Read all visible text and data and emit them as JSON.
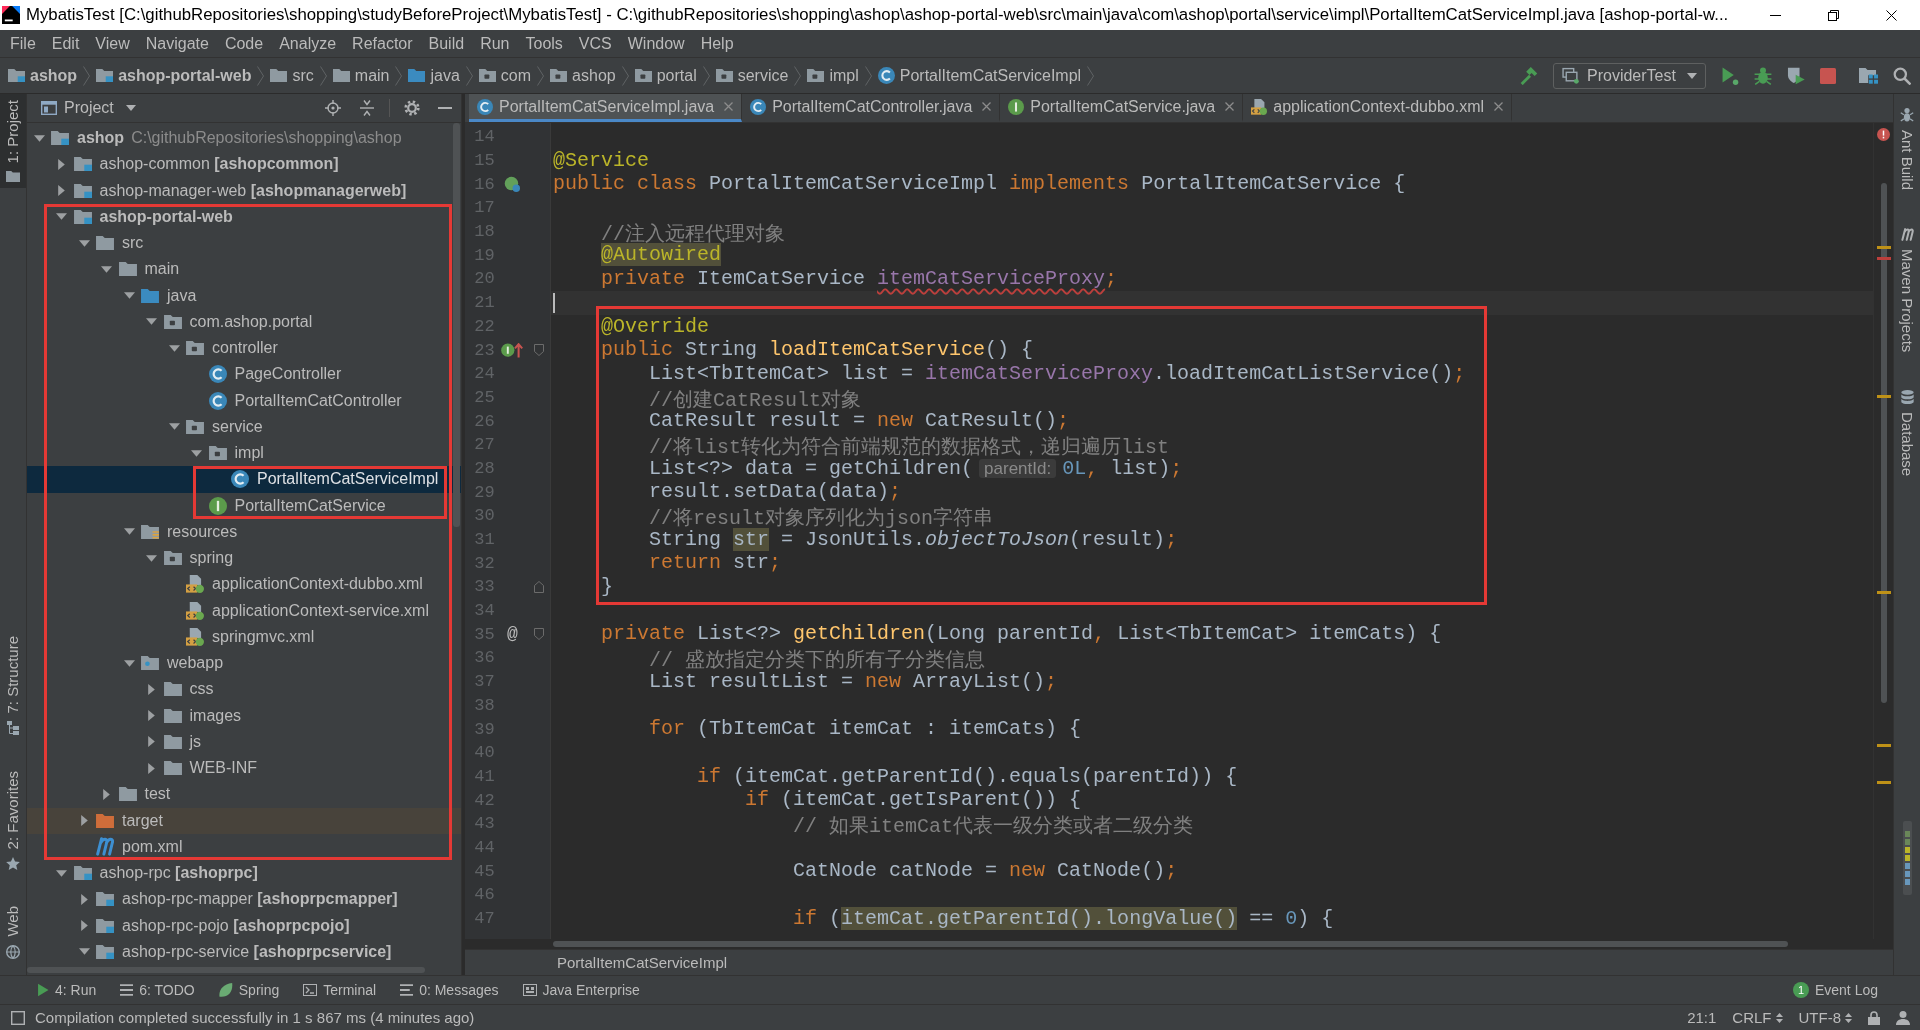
{
  "window": {
    "title": "MybatisTest [C:\\githubRepositories\\shopping\\studyBeforeProject\\MybatisTest] - C:\\githubRepositories\\shopping\\ashop\\ashop-portal-web\\src\\main\\java\\com\\ashop\\portal\\service\\impl\\PortalItemCatServiceImpl.java [ashop-portal-w..."
  },
  "menu": [
    "File",
    "Edit",
    "View",
    "Navigate",
    "Code",
    "Analyze",
    "Refactor",
    "Build",
    "Run",
    "Tools",
    "VCS",
    "Window",
    "Help"
  ],
  "breadcrumbs": [
    {
      "label": "ashop",
      "kind": "module"
    },
    {
      "label": "ashop-portal-web",
      "kind": "module"
    },
    {
      "label": "src",
      "kind": "folder"
    },
    {
      "label": "main",
      "kind": "folder"
    },
    {
      "label": "java",
      "kind": "source-root"
    },
    {
      "label": "com",
      "kind": "package"
    },
    {
      "label": "ashop",
      "kind": "package"
    },
    {
      "label": "portal",
      "kind": "package"
    },
    {
      "label": "service",
      "kind": "package"
    },
    {
      "label": "impl",
      "kind": "package"
    },
    {
      "label": "PortalItemCatServiceImpl",
      "kind": "class"
    }
  ],
  "run_config": {
    "label": "ProviderTest"
  },
  "left_strip": {
    "top": [
      {
        "label": "1: Project",
        "kind": "project",
        "selected": true
      }
    ],
    "bottom": [
      {
        "label": "7: Structure",
        "kind": "structure",
        "selected": false
      },
      {
        "label": "2: Favorites",
        "kind": "favorites",
        "selected": false
      },
      {
        "label": "Web",
        "kind": "web",
        "selected": false
      }
    ]
  },
  "right_strip": [
    {
      "label": "Ant Build",
      "kind": "ant"
    },
    {
      "label": "Maven Projects",
      "kind": "maven"
    },
    {
      "label": "Database",
      "kind": "database"
    }
  ],
  "project": {
    "title": "Project",
    "tree": [
      {
        "label": "ashop",
        "kind": "module",
        "bold": true,
        "path": "C:\\githubRepositories\\shopping\\ashop",
        "expanded": true,
        "selected": false,
        "children": [
          {
            "label": "ashop-common **[ashopcommon]**",
            "kind": "module",
            "bold": false,
            "expanded": false,
            "selected": false
          },
          {
            "label": "ashop-manager-web **[ashopmanagerweb]**",
            "kind": "module",
            "bold": false,
            "expanded": false,
            "selected": false
          },
          {
            "label": "ashop-portal-web",
            "kind": "module",
            "bold": true,
            "expanded": true,
            "selected": false,
            "framed": true,
            "children": [
              {
                "label": "src",
                "kind": "folder",
                "expanded": true,
                "selected": false,
                "children": [
                  {
                    "label": "main",
                    "kind": "folder",
                    "expanded": true,
                    "selected": false,
                    "children": [
                      {
                        "label": "java",
                        "kind": "source-root",
                        "expanded": true,
                        "selected": false,
                        "children": [
                          {
                            "label": "com.ashop.portal",
                            "kind": "package",
                            "expanded": true,
                            "selected": false,
                            "children": [
                              {
                                "label": "controller",
                                "kind": "package",
                                "expanded": true,
                                "selected": false,
                                "children": [
                                  {
                                    "label": "PageController",
                                    "kind": "class",
                                    "selected": false
                                  },
                                  {
                                    "label": "PortalItemCatController",
                                    "kind": "class",
                                    "selected": false
                                  }
                                ]
                              },
                              {
                                "label": "service",
                                "kind": "package",
                                "expanded": true,
                                "selected": false,
                                "children": [
                                  {
                                    "label": "impl",
                                    "kind": "package",
                                    "expanded": true,
                                    "selected": false,
                                    "children": [
                                      {
                                        "label": "PortalItemCatServiceImpl",
                                        "kind": "class",
                                        "selected": true,
                                        "framed": true
                                      }
                                    ]
                                  },
                                  {
                                    "label": "PortalItemCatService",
                                    "kind": "interface",
                                    "selected": false,
                                    "framed": true
                                  }
                                ]
                              }
                            ]
                          }
                        ]
                      },
                      {
                        "label": "resources",
                        "kind": "resources-root",
                        "expanded": true,
                        "selected": false,
                        "children": [
                          {
                            "label": "spring",
                            "kind": "package",
                            "expanded": true,
                            "selected": false,
                            "children": [
                              {
                                "label": "applicationContext-dubbo.xml",
                                "kind": "spring-xml",
                                "selected": false
                              },
                              {
                                "label": "applicationContext-service.xml",
                                "kind": "spring-xml",
                                "selected": false
                              },
                              {
                                "label": "springmvc.xml",
                                "kind": "spring-xml",
                                "selected": false
                              }
                            ]
                          }
                        ]
                      },
                      {
                        "label": "webapp",
                        "kind": "web-root",
                        "expanded": true,
                        "selected": false,
                        "children": [
                          {
                            "label": "css",
                            "kind": "folder",
                            "expanded": false,
                            "selected": false
                          },
                          {
                            "label": "images",
                            "kind": "folder",
                            "expanded": false,
                            "selected": false
                          },
                          {
                            "label": "js",
                            "kind": "folder",
                            "expanded": false,
                            "selected": false
                          },
                          {
                            "label": "WEB-INF",
                            "kind": "folder",
                            "expanded": false,
                            "selected": false
                          }
                        ]
                      }
                    ]
                  },
                  {
                    "label": "test",
                    "kind": "folder",
                    "expanded": false,
                    "selected": false
                  }
                ]
              },
              {
                "label": "target",
                "kind": "excluded",
                "expanded": false,
                "selected": false
              },
              {
                "label": "pom.xml",
                "kind": "maven",
                "selected": false
              }
            ]
          },
          {
            "label": "ashop-rpc **[ashoprpc]**",
            "kind": "module",
            "bold": false,
            "expanded": true,
            "selected": false,
            "children": [
              {
                "label": "ashop-rpc-mapper **[ashoprpcmapper]**",
                "kind": "module",
                "bold": false,
                "expanded": false,
                "selected": false
              },
              {
                "label": "ashop-rpc-pojo **[ashoprpcpojo]**",
                "kind": "module",
                "bold": false,
                "expanded": false,
                "selected": false
              },
              {
                "label": "ashop-rpc-service **[ashoprpcservice]**",
                "kind": "module",
                "bold": false,
                "expanded": true,
                "selected": false
              }
            ]
          }
        ]
      }
    ]
  },
  "editor": {
    "tabs": [
      {
        "label": "PortalItemCatServiceImpl.java",
        "kind": "class",
        "selected": true
      },
      {
        "label": "PortalItemCatController.java",
        "kind": "class",
        "selected": false
      },
      {
        "label": "PortalItemCatService.java",
        "kind": "interface",
        "selected": false
      },
      {
        "label": "applicationContext-dubbo.xml",
        "kind": "spring-xml",
        "selected": false
      }
    ],
    "blocks": [
      {
        "lines": [
          {
            "number": "14",
            "current": false
          },
          {
            "number": "15",
            "current": false,
            "tokens": [
              {
                "text": "@Service",
                "kind": "annotation"
              }
            ]
          },
          {
            "number": "16",
            "current": false,
            "gutter": {
              "kind": "bean"
            },
            "tokens": [
              {
                "text": "public class",
                "kind": "keyword"
              },
              {
                "text": " PortalItemCatServiceImpl ",
                "kind": "plain"
              },
              {
                "text": "implements",
                "kind": "keyword"
              },
              {
                "text": " PortalItemCatService {",
                "kind": "plain"
              }
            ]
          },
          {
            "number": "17",
            "current": false
          },
          {
            "number": "18",
            "current": false,
            "tokens": [
              {
                "text": "    //注入远程代理对象",
                "kind": "comment"
              }
            ]
          },
          {
            "number": "19",
            "current": false,
            "tokens": [
              {
                "text": "    @Autowired",
                "kind": "annotation",
                "warning": true
              }
            ]
          },
          {
            "number": "20",
            "current": false,
            "tokens": [
              {
                "text": "    private",
                "kind": "keyword"
              },
              {
                "text": " ItemCatService ",
                "kind": "plain"
              },
              {
                "text": "itemCatServiceProxy",
                "kind": "field",
                "error": true
              },
              {
                "text": ";",
                "kind": "punct"
              }
            ]
          },
          {
            "number": "21",
            "current": true
          }
        ]
      },
      {
        "framed": true,
        "lines": [
          {
            "number": "22",
            "current": false,
            "tokens": [
              {
                "text": "    @Override",
                "kind": "annotation"
              }
            ]
          },
          {
            "number": "23",
            "current": false,
            "gutter": {
              "kind": "implements"
            },
            "fold_start": true,
            "tokens": [
              {
                "text": "    public",
                "kind": "keyword"
              },
              {
                "text": " String ",
                "kind": "plain"
              },
              {
                "text": "loadItemCatService",
                "kind": "declaration"
              },
              {
                "text": "() {",
                "kind": "plain"
              }
            ]
          },
          {
            "number": "24",
            "current": false,
            "tokens": [
              {
                "text": "        List<TbItemCat> list = ",
                "kind": "plain"
              },
              {
                "text": "itemCatServiceProxy",
                "kind": "field"
              },
              {
                "text": ".loadItemCatListService()",
                "kind": "plain"
              },
              {
                "text": ";",
                "kind": "punct"
              }
            ]
          },
          {
            "number": "25",
            "current": false,
            "tokens": [
              {
                "text": "        //创建CatResult对象",
                "kind": "comment"
              }
            ]
          },
          {
            "number": "26",
            "current": false,
            "tokens": [
              {
                "text": "        CatResult result = ",
                "kind": "plain"
              },
              {
                "text": "new",
                "kind": "keyword"
              },
              {
                "text": " CatResult()",
                "kind": "plain"
              },
              {
                "text": ";",
                "kind": "punct"
              }
            ]
          },
          {
            "number": "27",
            "current": false,
            "tokens": [
              {
                "text": "        //将list转化为符合前端规范的数据格式，递归遍历list",
                "kind": "comment"
              }
            ]
          },
          {
            "number": "28",
            "current": false,
            "tokens": [
              {
                "text": "        List<?> data = getChildren(",
                "kind": "plain"
              },
              {
                "text": "parentId:",
                "kind": "hint"
              },
              {
                "text": "0L",
                "kind": "number"
              },
              {
                "text": ",",
                "kind": "punct"
              },
              {
                "text": " list)",
                "kind": "plain"
              },
              {
                "text": ";",
                "kind": "punct"
              }
            ]
          },
          {
            "number": "29",
            "current": false,
            "tokens": [
              {
                "text": "        result.setData(data)",
                "kind": "plain"
              },
              {
                "text": ";",
                "kind": "punct"
              }
            ]
          },
          {
            "number": "30",
            "current": false,
            "tokens": [
              {
                "text": "        //将result对象序列化为json字符串",
                "kind": "comment"
              }
            ]
          },
          {
            "number": "31",
            "current": false,
            "tokens": [
              {
                "text": "        String ",
                "kind": "plain"
              },
              {
                "text": "str",
                "kind": "plain",
                "warning": true
              },
              {
                "text": " = JsonUtils.",
                "kind": "plain"
              },
              {
                "text": "objectToJson",
                "kind": "static"
              },
              {
                "text": "(result)",
                "kind": "plain"
              },
              {
                "text": ";",
                "kind": "punct"
              }
            ]
          },
          {
            "number": "32",
            "current": false,
            "tokens": [
              {
                "text": "        return",
                "kind": "keyword"
              },
              {
                "text": " str",
                "kind": "plain"
              },
              {
                "text": ";",
                "kind": "punct"
              }
            ]
          },
          {
            "number": "33",
            "current": false,
            "fold_end": true,
            "tokens": [
              {
                "text": "    }",
                "kind": "plain"
              }
            ]
          }
        ]
      },
      {
        "lines": [
          {
            "number": "34",
            "current": false
          },
          {
            "number": "35",
            "current": false,
            "gutter": {
              "kind": "symbol",
              "text": "@"
            },
            "fold_start": true,
            "tokens": [
              {
                "text": "    private",
                "kind": "keyword"
              },
              {
                "text": " List<?> ",
                "kind": "plain"
              },
              {
                "text": "getChildren",
                "kind": "declaration"
              },
              {
                "text": "(Long parentId",
                "kind": "plain"
              },
              {
                "text": ",",
                "kind": "punct"
              },
              {
                "text": " List<TbItemCat> itemCats) {",
                "kind": "plain"
              }
            ]
          },
          {
            "number": "36",
            "current": false,
            "tokens": [
              {
                "text": "        // 盛放指定分类下的所有子分类信息",
                "kind": "comment"
              }
            ]
          },
          {
            "number": "37",
            "current": false,
            "tokens": [
              {
                "text": "        List resultList = ",
                "kind": "plain"
              },
              {
                "text": "new",
                "kind": "keyword"
              },
              {
                "text": " ArrayList()",
                "kind": "plain"
              },
              {
                "text": ";",
                "kind": "punct"
              }
            ]
          },
          {
            "number": "38",
            "current": false
          },
          {
            "number": "39",
            "current": false,
            "tokens": [
              {
                "text": "        for",
                "kind": "keyword"
              },
              {
                "text": " (TbItemCat itemCat : itemCats) {",
                "kind": "plain"
              }
            ]
          },
          {
            "number": "40",
            "current": false
          },
          {
            "number": "41",
            "current": false,
            "tokens": [
              {
                "text": "            if",
                "kind": "keyword"
              },
              {
                "text": " (itemCat.getParentId().equals(parentId)) {",
                "kind": "plain"
              }
            ]
          },
          {
            "number": "42",
            "current": false,
            "tokens": [
              {
                "text": "                if",
                "kind": "keyword"
              },
              {
                "text": " (itemCat.getIsParent()) {",
                "kind": "plain"
              }
            ]
          },
          {
            "number": "43",
            "current": false,
            "tokens": [
              {
                "text": "                    // 如果itemCat代表一级分类或者二级分类",
                "kind": "comment"
              }
            ]
          },
          {
            "number": "44",
            "current": false
          },
          {
            "number": "45",
            "current": false,
            "tokens": [
              {
                "text": "                    CatNode catNode = ",
                "kind": "plain"
              },
              {
                "text": "new",
                "kind": "keyword"
              },
              {
                "text": " CatNode()",
                "kind": "plain"
              },
              {
                "text": ";",
                "kind": "punct"
              }
            ]
          },
          {
            "number": "46",
            "current": false
          },
          {
            "number": "47",
            "current": false,
            "tokens": [
              {
                "text": "                    if",
                "kind": "keyword"
              },
              {
                "text": " (",
                "kind": "plain"
              },
              {
                "text": "itemCat.getParentId().longValue()",
                "kind": "plain",
                "warning": true
              },
              {
                "text": " == ",
                "kind": "plain"
              },
              {
                "text": "0",
                "kind": "number"
              },
              {
                "text": ") {",
                "kind": "plain"
              }
            ]
          }
        ]
      }
    ],
    "breadcrumb": "PortalItemCatServiceImpl"
  },
  "tool_windows": [
    {
      "label": "4: Run",
      "kind": "run"
    },
    {
      "label": "6: TODO",
      "kind": "todo"
    },
    {
      "label": "Spring",
      "kind": "spring"
    },
    {
      "label": "Terminal",
      "kind": "terminal"
    },
    {
      "label": "0: Messages",
      "kind": "messages"
    },
    {
      "label": "Java Enterprise",
      "kind": "javaee"
    }
  ],
  "event_log": {
    "label": "Event Log",
    "count": "1"
  },
  "status_bar": {
    "message": "Compilation completed successfully in 1 s 867 ms (4 minutes ago)",
    "position": "21:1",
    "line_separator": "CRLF",
    "encoding": "UTF-8"
  }
}
